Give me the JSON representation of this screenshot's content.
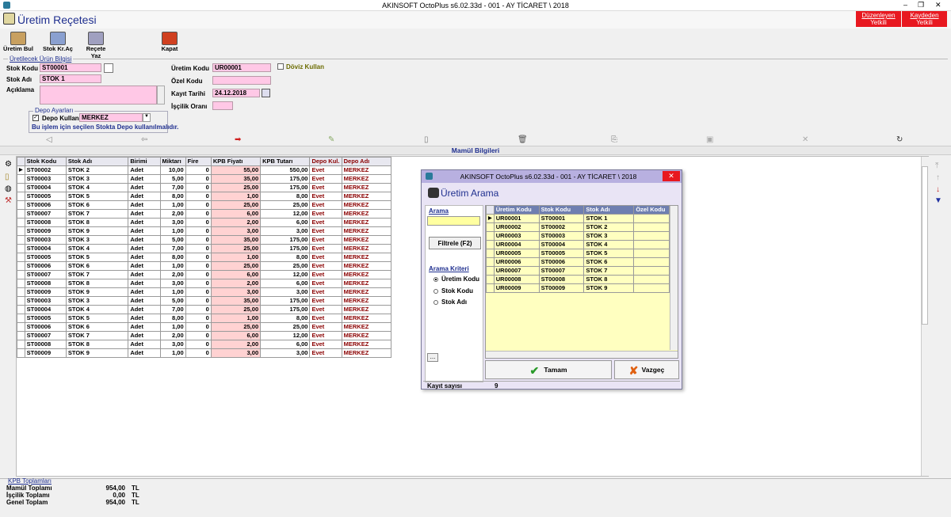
{
  "titlebar": {
    "title": "AKINSOFT OctoPlus s6.02.33d  -  001 - AY TİCARET \\ 2018",
    "min": "–",
    "restore": "❐",
    "close": "✕"
  },
  "header": {
    "title": "Üretim Reçetesi",
    "auth_edit_1": "Düzenleyen",
    "auth_edit_2": "Yetkili",
    "auth_saved_1": "Kaydeden",
    "auth_saved_2": "Yetkili"
  },
  "toolbar": {
    "search": "Üretim Bul",
    "stock_card": "Stok Kr.Aç",
    "print_recipe": "Reçete Yaz",
    "close": "Kapat"
  },
  "product_info": {
    "legend": "Üretilecek Ürün Bilgisi",
    "stock_code_label": "Stok Kodu",
    "stock_code": "ST00001",
    "stock_name_label": "Stok Adı",
    "stock_name": "STOK 1",
    "description_label": "Açıklama",
    "description": "",
    "production_code_label": "Üretim Kodu",
    "production_code": "UR00001",
    "special_code_label": "Özel Kodu",
    "special_code": "",
    "record_date_label": "Kayıt Tarihi",
    "record_date": "24.12.2018",
    "labor_rate_label": "İşçilik Oranı",
    "labor_rate": "",
    "currency_label": "Döviz Kullan"
  },
  "depot": {
    "legend": "Depo Ayarları",
    "use_label": "Depo Kullan",
    "value": "MERKEZ",
    "note": "Bu işlem için seçilen Stokta Depo kullanılmalıdır."
  },
  "section_title": "Mamül Bilgileri",
  "grid": {
    "headers": [
      "Stok Kodu",
      "Stok Adı",
      "Birimi",
      "Miktarı",
      "Fire",
      "KPB Fiyatı",
      "KPB Tutarı",
      "Depo Kul.",
      "Depo Adı"
    ],
    "rows": [
      [
        "ST00002",
        "STOK 2",
        "Adet",
        "10,00",
        "0",
        "55,00",
        "550,00",
        "Evet",
        "MERKEZ"
      ],
      [
        "ST00003",
        "STOK 3",
        "Adet",
        "5,00",
        "0",
        "35,00",
        "175,00",
        "Evet",
        "MERKEZ"
      ],
      [
        "ST00004",
        "STOK 4",
        "Adet",
        "7,00",
        "0",
        "25,00",
        "175,00",
        "Evet",
        "MERKEZ"
      ],
      [
        "ST00005",
        "STOK 5",
        "Adet",
        "8,00",
        "0",
        "1,00",
        "8,00",
        "Evet",
        "MERKEZ"
      ],
      [
        "ST00006",
        "STOK 6",
        "Adet",
        "1,00",
        "0",
        "25,00",
        "25,00",
        "Evet",
        "MERKEZ"
      ],
      [
        "ST00007",
        "STOK 7",
        "Adet",
        "2,00",
        "0",
        "6,00",
        "12,00",
        "Evet",
        "MERKEZ"
      ],
      [
        "ST00008",
        "STOK 8",
        "Adet",
        "3,00",
        "0",
        "2,00",
        "6,00",
        "Evet",
        "MERKEZ"
      ],
      [
        "ST00009",
        "STOK 9",
        "Adet",
        "1,00",
        "0",
        "3,00",
        "3,00",
        "Evet",
        "MERKEZ"
      ],
      [
        "ST00003",
        "STOK 3",
        "Adet",
        "5,00",
        "0",
        "35,00",
        "175,00",
        "Evet",
        "MERKEZ"
      ],
      [
        "ST00004",
        "STOK 4",
        "Adet",
        "7,00",
        "0",
        "25,00",
        "175,00",
        "Evet",
        "MERKEZ"
      ],
      [
        "ST00005",
        "STOK 5",
        "Adet",
        "8,00",
        "0",
        "1,00",
        "8,00",
        "Evet",
        "MERKEZ"
      ],
      [
        "ST00006",
        "STOK 6",
        "Adet",
        "1,00",
        "0",
        "25,00",
        "25,00",
        "Evet",
        "MERKEZ"
      ],
      [
        "ST00007",
        "STOK 7",
        "Adet",
        "2,00",
        "0",
        "6,00",
        "12,00",
        "Evet",
        "MERKEZ"
      ],
      [
        "ST00008",
        "STOK 8",
        "Adet",
        "3,00",
        "0",
        "2,00",
        "6,00",
        "Evet",
        "MERKEZ"
      ],
      [
        "ST00009",
        "STOK 9",
        "Adet",
        "1,00",
        "0",
        "3,00",
        "3,00",
        "Evet",
        "MERKEZ"
      ],
      [
        "ST00003",
        "STOK 3",
        "Adet",
        "5,00",
        "0",
        "35,00",
        "175,00",
        "Evet",
        "MERKEZ"
      ],
      [
        "ST00004",
        "STOK 4",
        "Adet",
        "7,00",
        "0",
        "25,00",
        "175,00",
        "Evet",
        "MERKEZ"
      ],
      [
        "ST00005",
        "STOK 5",
        "Adet",
        "8,00",
        "0",
        "1,00",
        "8,00",
        "Evet",
        "MERKEZ"
      ],
      [
        "ST00006",
        "STOK 6",
        "Adet",
        "1,00",
        "0",
        "25,00",
        "25,00",
        "Evet",
        "MERKEZ"
      ],
      [
        "ST00007",
        "STOK 7",
        "Adet",
        "2,00",
        "0",
        "6,00",
        "12,00",
        "Evet",
        "MERKEZ"
      ],
      [
        "ST00008",
        "STOK 8",
        "Adet",
        "3,00",
        "0",
        "2,00",
        "6,00",
        "Evet",
        "MERKEZ"
      ],
      [
        "ST00009",
        "STOK 9",
        "Adet",
        "1,00",
        "0",
        "3,00",
        "3,00",
        "Evet",
        "MERKEZ"
      ]
    ]
  },
  "totals": {
    "legend": "KPB Toplamları",
    "product_label": "Mamül Toplamı",
    "product_value": "954,00",
    "labor_label": "İşçilik Toplamı",
    "labor_value": "0,00",
    "grand_label": "Genel Toplam",
    "grand_value": "954,00",
    "currency": "TL"
  },
  "dialog": {
    "window_title": "AKINSOFT OctoPlus s6.02.33d  -  001 - AY TİCARET \\ 2018",
    "close": "✕",
    "title": "Üretim Arama",
    "search_label": "Arama",
    "search_value": "",
    "filter_button": "Filtrele (F2)",
    "criteria_label": "Arama Kriteri",
    "criteria": [
      "Üretim Kodu",
      "Stok Kodu",
      "Stok Adı"
    ],
    "more": "...",
    "headers": [
      "Üretim Kodu",
      "Stok Kodu",
      "Stok Adı",
      "Özel Kodu"
    ],
    "rows": [
      [
        "UR00001",
        "ST00001",
        "STOK 1",
        ""
      ],
      [
        "UR00002",
        "ST00002",
        "STOK 2",
        ""
      ],
      [
        "UR00003",
        "ST00003",
        "STOK 3",
        ""
      ],
      [
        "UR00004",
        "ST00004",
        "STOK 4",
        ""
      ],
      [
        "UR00005",
        "ST00005",
        "STOK 5",
        ""
      ],
      [
        "UR00006",
        "ST00006",
        "STOK 6",
        ""
      ],
      [
        "UR00007",
        "ST00007",
        "STOK 7",
        ""
      ],
      [
        "UR00008",
        "ST00008",
        "STOK 8",
        ""
      ],
      [
        "UR00009",
        "ST00009",
        "STOK 9",
        ""
      ]
    ],
    "ok_button": "Tamam",
    "cancel_button": "Vazgeç",
    "record_count_label": "Kayıt sayısı",
    "record_count": "9"
  }
}
